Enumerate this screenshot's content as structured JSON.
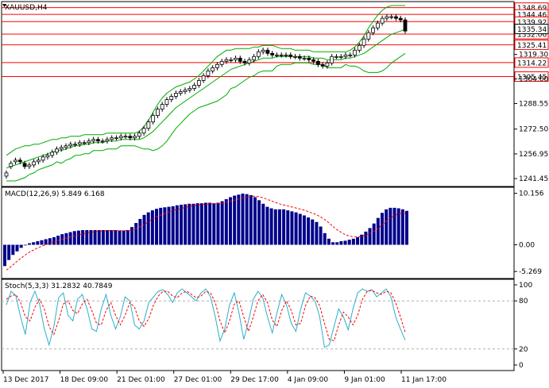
{
  "chart_data": [
    {
      "type": "candlestick",
      "title": "XAUUSD,H4",
      "symbol_label": "XAUUSD,H4",
      "y_ticks": [
        "1319.30",
        "1304.00",
        "1288.55",
        "1272.50",
        "1256.95",
        "1241.45"
      ],
      "ylim": [
        1237,
        1352
      ],
      "level_lines": [
        1348.69,
        1344.46,
        1339.92,
        1332.06,
        1325.41,
        1314.22,
        1305.45
      ],
      "level_labels": [
        "1348.69",
        "1344.46",
        "1339.92",
        "1332.06",
        "1325.41",
        "1314.22",
        "1305.45"
      ],
      "current_price": "1335.34",
      "current_value": 1335.34,
      "closes": [
        1245,
        1251,
        1253,
        1252,
        1249,
        1250,
        1252,
        1253,
        1255,
        1256,
        1258,
        1260,
        1261,
        1262,
        1263,
        1263,
        1264,
        1264,
        1265,
        1266,
        1265,
        1265,
        1266,
        1267,
        1267,
        1268,
        1268,
        1267,
        1268,
        1270,
        1273,
        1277,
        1281,
        1285,
        1288,
        1291,
        1293,
        1295,
        1296,
        1297,
        1298,
        1300,
        1303,
        1306,
        1309,
        1311,
        1313,
        1315,
        1316,
        1316,
        1317,
        1315,
        1314,
        1316,
        1318,
        1321,
        1322,
        1320,
        1319,
        1319,
        1319,
        1319,
        1318,
        1318,
        1317,
        1317,
        1316,
        1315,
        1313,
        1312,
        1314,
        1318,
        1318,
        1318,
        1319,
        1319,
        1322,
        1325,
        1329,
        1333,
        1336,
        1339,
        1342,
        1343,
        1343,
        1342,
        1341,
        1334
      ],
      "opens": [
        1243,
        1249,
        1252,
        1253,
        1251,
        1249,
        1250,
        1252,
        1253,
        1255,
        1256,
        1258,
        1260,
        1261,
        1262,
        1263,
        1263,
        1264,
        1264,
        1265,
        1266,
        1265,
        1265,
        1266,
        1267,
        1267,
        1268,
        1268,
        1267,
        1268,
        1270,
        1273,
        1277,
        1281,
        1285,
        1288,
        1291,
        1293,
        1295,
        1296,
        1297,
        1298,
        1300,
        1303,
        1306,
        1309,
        1311,
        1313,
        1315,
        1316,
        1316,
        1317,
        1315,
        1314,
        1316,
        1318,
        1321,
        1322,
        1320,
        1319,
        1319,
        1319,
        1319,
        1318,
        1318,
        1317,
        1317,
        1316,
        1315,
        1313,
        1312,
        1314,
        1318,
        1318,
        1318,
        1319,
        1319,
        1322,
        1325,
        1329,
        1333,
        1336,
        1339,
        1342,
        1343,
        1343,
        1342,
        1341
      ],
      "bollinger_upper": [
        1256,
        1258,
        1260,
        1261,
        1262,
        1262,
        1263,
        1263,
        1264,
        1265,
        1266,
        1266,
        1267,
        1267,
        1268,
        1268,
        1268,
        1269,
        1269,
        1269,
        1269,
        1269,
        1270,
        1270,
        1270,
        1270,
        1270,
        1270,
        1270,
        1271,
        1274,
        1278,
        1283,
        1288,
        1292,
        1295,
        1297,
        1299,
        1300,
        1301,
        1302,
        1304,
        1306,
        1309,
        1312,
        1315,
        1318,
        1320,
        1322,
        1322,
        1323,
        1323,
        1323,
        1323,
        1324,
        1324,
        1325,
        1325,
        1325,
        1324,
        1323,
        1323,
        1323,
        1322,
        1322,
        1322,
        1322,
        1321,
        1321,
        1321,
        1321,
        1321,
        1321,
        1321,
        1321,
        1322,
        1324,
        1327,
        1331,
        1336,
        1340,
        1344,
        1347,
        1349,
        1350,
        1350,
        1350,
        1350
      ],
      "bollinger_middle": [
        1248,
        1249,
        1250,
        1251,
        1252,
        1253,
        1254,
        1255,
        1256,
        1257,
        1258,
        1259,
        1259,
        1260,
        1261,
        1262,
        1262,
        1263,
        1263,
        1264,
        1264,
        1264,
        1265,
        1265,
        1265,
        1266,
        1266,
        1266,
        1266,
        1266,
        1267,
        1269,
        1271,
        1274,
        1277,
        1280,
        1283,
        1286,
        1288,
        1290,
        1292,
        1294,
        1296,
        1298,
        1300,
        1302,
        1304,
        1306,
        1308,
        1310,
        1311,
        1312,
        1313,
        1314,
        1315,
        1316,
        1317,
        1317,
        1317,
        1318,
        1318,
        1318,
        1318,
        1318,
        1318,
        1318,
        1318,
        1317,
        1317,
        1317,
        1316,
        1316,
        1316,
        1316,
        1317,
        1317,
        1318,
        1319,
        1320,
        1322,
        1324,
        1326,
        1328,
        1330,
        1332,
        1333,
        1334,
        1335
      ],
      "bollinger_lower": [
        1240,
        1240,
        1240,
        1241,
        1242,
        1244,
        1245,
        1247,
        1248,
        1249,
        1250,
        1252,
        1251,
        1253,
        1254,
        1256,
        1256,
        1257,
        1257,
        1259,
        1259,
        1259,
        1260,
        1260,
        1260,
        1262,
        1262,
        1262,
        1262,
        1261,
        1260,
        1260,
        1259,
        1260,
        1262,
        1265,
        1269,
        1273,
        1276,
        1279,
        1282,
        1284,
        1286,
        1287,
        1288,
        1289,
        1290,
        1292,
        1294,
        1298,
        1299,
        1301,
        1303,
        1305,
        1306,
        1308,
        1309,
        1309,
        1309,
        1312,
        1313,
        1313,
        1313,
        1314,
        1314,
        1314,
        1314,
        1313,
        1313,
        1313,
        1311,
        1311,
        1311,
        1311,
        1313,
        1312,
        1312,
        1311,
        1309,
        1308,
        1308,
        1308,
        1309,
        1311,
        1314,
        1316,
        1318,
        1320
      ],
      "x_labels": [
        "13 Dec 2017",
        "18 Dec 09:00",
        "21 Dec 01:00",
        "27 Dec 01:00",
        "29 Dec 17:00",
        "4 Jan 09:00",
        "9 Jan 01:00",
        "11 Jan 17:00"
      ],
      "colors": {
        "bull_candle": "#000000",
        "bear_candle": "#000000",
        "bands": "#00aa00",
        "levels": "#ff0000",
        "tag_fill": "#ffffff",
        "current_tag_fill": "#ffffff"
      }
    },
    {
      "type": "bar",
      "title": "MACD(12,26,9) 5.849 6.168",
      "label": "MACD(12,26,9) 5.849 6.168",
      "y_ticks": [
        "10.156",
        "0.00",
        "-5.269"
      ],
      "ylim": [
        -6.5,
        11.2
      ],
      "histogram": [
        -4.2,
        -3.0,
        -2.0,
        -1.3,
        -0.6,
        0.0,
        0.3,
        0.5,
        0.7,
        0.9,
        1.1,
        1.3,
        1.5,
        1.8,
        2.1,
        2.3,
        2.5,
        2.7,
        2.8,
        2.9,
        2.9,
        2.9,
        2.9,
        2.9,
        2.9,
        2.9,
        2.9,
        2.9,
        2.8,
        2.8,
        2.9,
        3.5,
        4.3,
        5.1,
        5.9,
        6.4,
        6.8,
        7.1,
        7.3,
        7.4,
        7.5,
        7.6,
        7.8,
        7.9,
        8.0,
        8.1,
        8.1,
        8.2,
        8.2,
        8.3,
        8.3,
        8.2,
        8.3,
        8.6,
        9.0,
        9.4,
        9.7,
        9.9,
        10.1,
        10.0,
        9.8,
        9.4,
        8.8,
        8.1,
        7.5,
        7.2,
        7.0,
        7.0,
        7.0,
        6.8,
        6.6,
        6.4,
        6.1,
        5.8,
        5.4,
        5.0,
        4.5,
        3.6,
        2.3,
        1.2,
        0.5,
        0.5,
        0.7,
        0.8,
        1.0,
        1.2,
        1.5,
        2.0,
        2.6,
        3.3,
        4.2,
        5.3,
        6.3,
        7.0,
        7.3,
        7.3,
        7.2,
        7.0,
        6.7
      ],
      "signal": [
        -5.0,
        -4.4,
        -3.7,
        -3.0,
        -2.4,
        -1.8,
        -1.3,
        -0.9,
        -0.5,
        -0.2,
        0.1,
        0.4,
        0.6,
        0.9,
        1.1,
        1.4,
        1.6,
        1.8,
        2.0,
        2.2,
        2.4,
        2.5,
        2.6,
        2.7,
        2.7,
        2.8,
        2.8,
        2.8,
        2.8,
        2.8,
        2.8,
        2.9,
        3.2,
        3.6,
        4.1,
        4.6,
        5.1,
        5.5,
        5.9,
        6.2,
        6.5,
        6.8,
        7.0,
        7.2,
        7.4,
        7.6,
        7.7,
        7.8,
        7.9,
        8.0,
        8.1,
        8.1,
        8.1,
        8.2,
        8.4,
        8.6,
        8.8,
        9.0,
        9.2,
        9.4,
        9.5,
        9.6,
        9.5,
        9.3,
        9.0,
        8.7,
        8.4,
        8.1,
        7.9,
        7.7,
        7.5,
        7.3,
        7.1,
        6.9,
        6.6,
        6.3,
        6.0,
        5.6,
        5.1,
        4.5,
        3.8,
        3.1,
        2.6,
        2.1,
        1.8,
        1.6,
        1.6,
        1.6,
        1.8,
        2.1,
        2.5,
        3.0,
        3.7,
        4.4,
        5.1,
        5.6,
        6.0,
        6.2,
        6.2
      ],
      "colors": {
        "histogram": "#00008b",
        "signal": "#ff0000"
      }
    },
    {
      "type": "line",
      "title": "Stoch(5,3,3) 31.2832 40.7849",
      "label": "Stoch(5,3,3) 31.2832 40.7849",
      "y_ticks": [
        "100",
        "80",
        "20",
        "0"
      ],
      "ylim": [
        0,
        100
      ],
      "levels": [
        80,
        20
      ],
      "main": [
        75,
        92,
        86,
        60,
        38,
        78,
        92,
        76,
        45,
        25,
        48,
        84,
        90,
        62,
        55,
        82,
        88,
        70,
        45,
        42,
        70,
        88,
        62,
        45,
        60,
        85,
        80,
        50,
        45,
        55,
        78,
        85,
        92,
        94,
        88,
        78,
        90,
        95,
        90,
        85,
        80,
        90,
        95,
        85,
        60,
        30,
        45,
        75,
        90,
        65,
        32,
        55,
        82,
        92,
        84,
        60,
        40,
        65,
        88,
        75,
        52,
        42,
        70,
        90,
        86,
        80,
        60,
        22,
        25,
        48,
        70,
        60,
        44,
        70,
        90,
        95,
        92,
        94,
        85,
        90,
        95,
        85,
        60,
        45,
        31
      ],
      "signal": [
        82,
        86,
        88,
        78,
        60,
        55,
        72,
        82,
        70,
        48,
        38,
        55,
        76,
        80,
        68,
        64,
        76,
        82,
        68,
        52,
        50,
        68,
        78,
        62,
        50,
        62,
        78,
        72,
        55,
        48,
        58,
        75,
        86,
        92,
        92,
        86,
        84,
        90,
        92,
        88,
        84,
        86,
        92,
        90,
        78,
        55,
        40,
        55,
        76,
        80,
        60,
        42,
        60,
        80,
        88,
        78,
        56,
        48,
        68,
        80,
        68,
        50,
        52,
        74,
        86,
        84,
        74,
        52,
        32,
        30,
        50,
        66,
        60,
        50,
        62,
        82,
        92,
        93,
        90,
        88,
        92,
        90,
        78,
        60,
        41
      ],
      "colors": {
        "main": "#2ab0c8",
        "signal": "#ff0000",
        "levels": "#b0b0b0"
      }
    }
  ]
}
